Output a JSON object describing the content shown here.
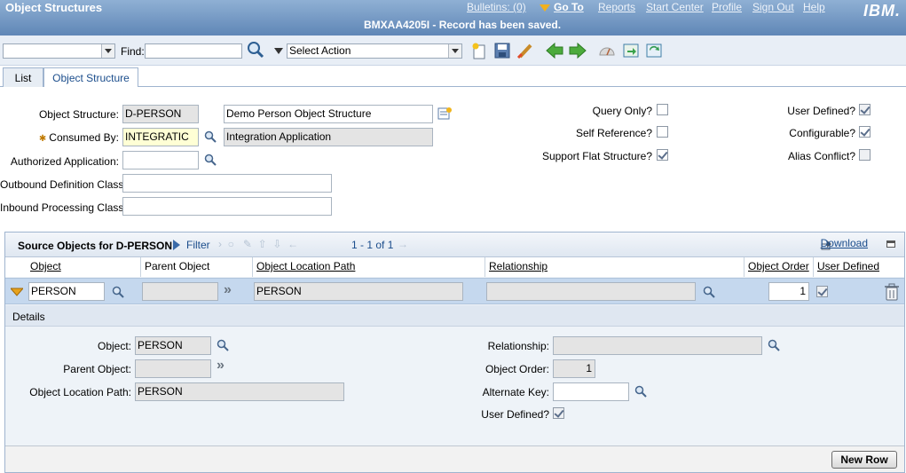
{
  "header": {
    "app_title": "Object Structures",
    "status_message": "BMXAA4205I - Record has been saved.",
    "links": {
      "bulletins": "Bulletins: (0)",
      "goto": "Go To",
      "reports": "Reports",
      "start_center": "Start Center",
      "profile": "Profile",
      "sign_out": "Sign Out",
      "help": "Help"
    },
    "logo": "IBM."
  },
  "toolbar": {
    "find_label": "Find:",
    "find_value": "",
    "query_value": "",
    "select_action": "Select Action"
  },
  "tabs": [
    {
      "label": "List"
    },
    {
      "label": "Object Structure"
    }
  ],
  "form": {
    "object_structure": {
      "label": "Object Structure:",
      "value": "D-PERSON",
      "description": "Demo Person Object Structure"
    },
    "consumed_by": {
      "label": "Consumed By:",
      "value": "INTEGRATIC",
      "description": "Integration Application"
    },
    "authorized_application": {
      "label": "Authorized Application:",
      "value": ""
    },
    "outbound_definition_class": {
      "label": "Outbound Definition Class:",
      "value": ""
    },
    "inbound_processing_class": {
      "label": "Inbound Processing Class:",
      "value": ""
    },
    "query_only": {
      "label": "Query Only?",
      "checked": false
    },
    "self_reference": {
      "label": "Self Reference?",
      "checked": false
    },
    "support_flat_structure": {
      "label": "Support Flat Structure?",
      "checked": true
    },
    "user_defined": {
      "label": "User Defined?",
      "checked": true
    },
    "configurable": {
      "label": "Configurable?",
      "checked": true
    },
    "alias_conflict": {
      "label": "Alias Conflict?",
      "checked": false
    }
  },
  "table": {
    "title": "Source Objects for D-PERSON",
    "filter_label": "Filter",
    "pager": "1 - 1 of 1",
    "download": "Download",
    "columns": [
      "Object",
      "Parent Object",
      "Object Location Path",
      "Relationship",
      "Object Order",
      "User Defined"
    ],
    "rows": [
      {
        "object": "PERSON",
        "parent_object": "",
        "location_path": "PERSON",
        "relationship": "",
        "object_order": "1",
        "user_defined": true
      }
    ],
    "details": {
      "title": "Details",
      "object": {
        "label": "Object:",
        "value": "PERSON"
      },
      "parent_object": {
        "label": "Parent Object:",
        "value": ""
      },
      "location_path": {
        "label": "Object Location Path:",
        "value": "PERSON"
      },
      "relationship": {
        "label": "Relationship:",
        "value": ""
      },
      "object_order": {
        "label": "Object Order:",
        "value": "1"
      },
      "alternate_key": {
        "label": "Alternate Key:",
        "value": ""
      },
      "user_defined": {
        "label": "User Defined?",
        "checked": true
      }
    },
    "new_row": "New Row"
  },
  "colors": {
    "header_blue": "#5f86b6",
    "link_blue": "#1b4d8c",
    "selected_row": "#c5d8ee"
  }
}
